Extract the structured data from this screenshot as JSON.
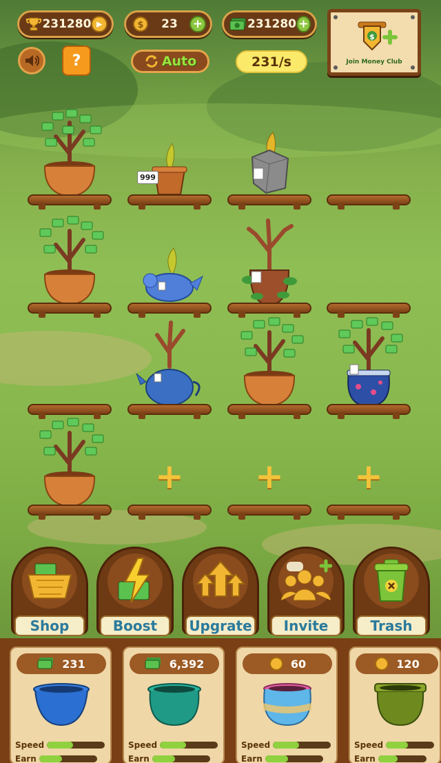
{
  "top_bar": {
    "trophy_value": "231280",
    "coin_value": "23",
    "cash_value": "231280"
  },
  "money_club": {
    "label": "Join Money Club"
  },
  "auto_label": "Auto",
  "rate_label": "231/s",
  "pot_tags": {
    "slot_1": "999"
  },
  "actions": [
    {
      "label": "Shop"
    },
    {
      "label": "Boost"
    },
    {
      "label": "Upgrate"
    },
    {
      "label": "Invite"
    },
    {
      "label": "Trash"
    }
  ],
  "shop_cards": [
    {
      "price": "231",
      "currency": "cash",
      "pot_color": "#2a6fd1",
      "speed": 0.45,
      "earn": 0.4
    },
    {
      "price": "6,392",
      "currency": "cash",
      "pot_color": "#1f9a86",
      "speed": 0.45,
      "earn": 0.4
    },
    {
      "price": "60",
      "currency": "coin",
      "pot_color": "#5fb6e8",
      "speed": 0.45,
      "earn": 0.4
    },
    {
      "price": "120",
      "currency": "coin",
      "pot_color": "#6e8a1e",
      "speed": 0.45,
      "earn": 0.4
    }
  ],
  "stat_labels": {
    "speed": "Speed",
    "earn": "Earn"
  },
  "colors": {
    "accent_green": "#8cc63f",
    "wood": "#7a3f14",
    "gold": "#f3c33a"
  }
}
